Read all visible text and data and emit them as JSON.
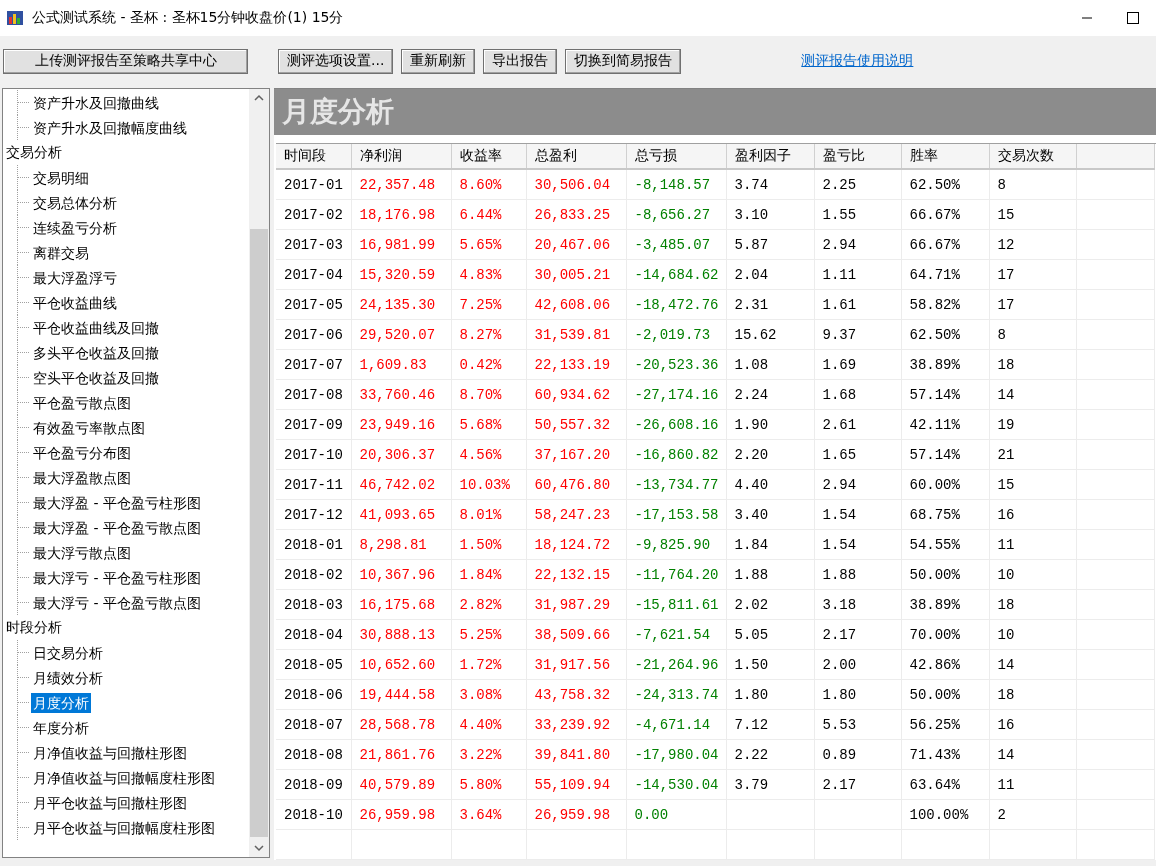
{
  "window": {
    "title": "公式测试系统 - 圣杯 : 圣杯15分钟收盘价(1) 15分"
  },
  "toolbar": {
    "buttons": [
      {
        "label": "上传测评报告至策略共享中心",
        "kind": "wide"
      },
      {
        "label": "测评选项设置...",
        "kind": "normal"
      },
      {
        "label": "重新刷新",
        "kind": "normal"
      },
      {
        "label": "导出报告",
        "kind": "normal"
      },
      {
        "label": "切换到简易报告",
        "kind": "normal"
      }
    ],
    "link": "测评报告使用说明"
  },
  "tree": [
    {
      "children": [
        {
          "label": "资产升水及回撤曲线",
          "selected": false
        },
        {
          "label": "资产升水及回撤幅度曲线",
          "selected": false
        }
      ]
    },
    {
      "label": "交易分析",
      "children": [
        {
          "label": "交易明细",
          "selected": false
        },
        {
          "label": "交易总体分析",
          "selected": false
        },
        {
          "label": "连续盈亏分析",
          "selected": false
        },
        {
          "label": "离群交易",
          "selected": false
        },
        {
          "label": "最大浮盈浮亏",
          "selected": false
        },
        {
          "label": "平仓收益曲线",
          "selected": false
        },
        {
          "label": "平仓收益曲线及回撤",
          "selected": false
        },
        {
          "label": "多头平仓收益及回撤",
          "selected": false
        },
        {
          "label": "空头平仓收益及回撤",
          "selected": false
        },
        {
          "label": "平仓盈亏散点图",
          "selected": false
        },
        {
          "label": "有效盈亏率散点图",
          "selected": false
        },
        {
          "label": "平仓盈亏分布图",
          "selected": false
        },
        {
          "label": "最大浮盈散点图",
          "selected": false
        },
        {
          "label": "最大浮盈 - 平仓盈亏柱形图",
          "selected": false
        },
        {
          "label": "最大浮盈 - 平仓盈亏散点图",
          "selected": false
        },
        {
          "label": "最大浮亏散点图",
          "selected": false
        },
        {
          "label": "最大浮亏 - 平仓盈亏柱形图",
          "selected": false
        },
        {
          "label": "最大浮亏 - 平仓盈亏散点图",
          "selected": false
        }
      ]
    },
    {
      "label": "时段分析",
      "children": [
        {
          "label": "日交易分析",
          "selected": false
        },
        {
          "label": "月绩效分析",
          "selected": false
        },
        {
          "label": "月度分析",
          "selected": true
        },
        {
          "label": "年度分析",
          "selected": false
        },
        {
          "label": "月净值收益与回撤柱形图",
          "selected": false
        },
        {
          "label": "月净值收益与回撤幅度柱形图",
          "selected": false
        },
        {
          "label": "月平仓收益与回撤柱形图",
          "selected": false
        },
        {
          "label": "月平仓收益与回撤幅度柱形图",
          "selected": false
        }
      ]
    }
  ],
  "report": {
    "title": "月度分析",
    "columns": [
      {
        "label": "时间段",
        "kind": "plain"
      },
      {
        "label": "净利润",
        "kind": "gain"
      },
      {
        "label": "收益率",
        "kind": "gain"
      },
      {
        "label": "总盈利",
        "kind": "gain"
      },
      {
        "label": "总亏损",
        "kind": "loss"
      },
      {
        "label": "盈利因子",
        "kind": "plain"
      },
      {
        "label": "盈亏比",
        "kind": "plain"
      },
      {
        "label": "胜率",
        "kind": "plain"
      },
      {
        "label": "交易次数",
        "kind": "plain"
      }
    ],
    "rows": [
      [
        "2017-01",
        "22,357.48",
        "8.60%",
        "30,506.04",
        "-8,148.57",
        "3.74",
        "2.25",
        "62.50%",
        "8"
      ],
      [
        "2017-02",
        "18,176.98",
        "6.44%",
        "26,833.25",
        "-8,656.27",
        "3.10",
        "1.55",
        "66.67%",
        "15"
      ],
      [
        "2017-03",
        "16,981.99",
        "5.65%",
        "20,467.06",
        "-3,485.07",
        "5.87",
        "2.94",
        "66.67%",
        "12"
      ],
      [
        "2017-04",
        "15,320.59",
        "4.83%",
        "30,005.21",
        "-14,684.62",
        "2.04",
        "1.11",
        "64.71%",
        "17"
      ],
      [
        "2017-05",
        "24,135.30",
        "7.25%",
        "42,608.06",
        "-18,472.76",
        "2.31",
        "1.61",
        "58.82%",
        "17"
      ],
      [
        "2017-06",
        "29,520.07",
        "8.27%",
        "31,539.81",
        "-2,019.73",
        "15.62",
        "9.37",
        "62.50%",
        "8"
      ],
      [
        "2017-07",
        "1,609.83",
        "0.42%",
        "22,133.19",
        "-20,523.36",
        "1.08",
        "1.69",
        "38.89%",
        "18"
      ],
      [
        "2017-08",
        "33,760.46",
        "8.70%",
        "60,934.62",
        "-27,174.16",
        "2.24",
        "1.68",
        "57.14%",
        "14"
      ],
      [
        "2017-09",
        "23,949.16",
        "5.68%",
        "50,557.32",
        "-26,608.16",
        "1.90",
        "2.61",
        "42.11%",
        "19"
      ],
      [
        "2017-10",
        "20,306.37",
        "4.56%",
        "37,167.20",
        "-16,860.82",
        "2.20",
        "1.65",
        "57.14%",
        "21"
      ],
      [
        "2017-11",
        "46,742.02",
        "10.03%",
        "60,476.80",
        "-13,734.77",
        "4.40",
        "2.94",
        "60.00%",
        "15"
      ],
      [
        "2017-12",
        "41,093.65",
        "8.01%",
        "58,247.23",
        "-17,153.58",
        "3.40",
        "1.54",
        "68.75%",
        "16"
      ],
      [
        "2018-01",
        "8,298.81",
        "1.50%",
        "18,124.72",
        "-9,825.90",
        "1.84",
        "1.54",
        "54.55%",
        "11"
      ],
      [
        "2018-02",
        "10,367.96",
        "1.84%",
        "22,132.15",
        "-11,764.20",
        "1.88",
        "1.88",
        "50.00%",
        "10"
      ],
      [
        "2018-03",
        "16,175.68",
        "2.82%",
        "31,987.29",
        "-15,811.61",
        "2.02",
        "3.18",
        "38.89%",
        "18"
      ],
      [
        "2018-04",
        "30,888.13",
        "5.25%",
        "38,509.66",
        "-7,621.54",
        "5.05",
        "2.17",
        "70.00%",
        "10"
      ],
      [
        "2018-05",
        "10,652.60",
        "1.72%",
        "31,917.56",
        "-21,264.96",
        "1.50",
        "2.00",
        "42.86%",
        "14"
      ],
      [
        "2018-06",
        "19,444.58",
        "3.08%",
        "43,758.32",
        "-24,313.74",
        "1.80",
        "1.80",
        "50.00%",
        "18"
      ],
      [
        "2018-07",
        "28,568.78",
        "4.40%",
        "33,239.92",
        "-4,671.14",
        "7.12",
        "5.53",
        "56.25%",
        "16"
      ],
      [
        "2018-08",
        "21,861.76",
        "3.22%",
        "39,841.80",
        "-17,980.04",
        "2.22",
        "0.89",
        "71.43%",
        "14"
      ],
      [
        "2018-09",
        "40,579.89",
        "5.80%",
        "55,109.94",
        "-14,530.04",
        "3.79",
        "2.17",
        "63.64%",
        "11"
      ],
      [
        "2018-10",
        "26,959.98",
        "3.64%",
        "26,959.98",
        "0.00",
        null,
        null,
        "100.00%",
        "2"
      ]
    ]
  }
}
